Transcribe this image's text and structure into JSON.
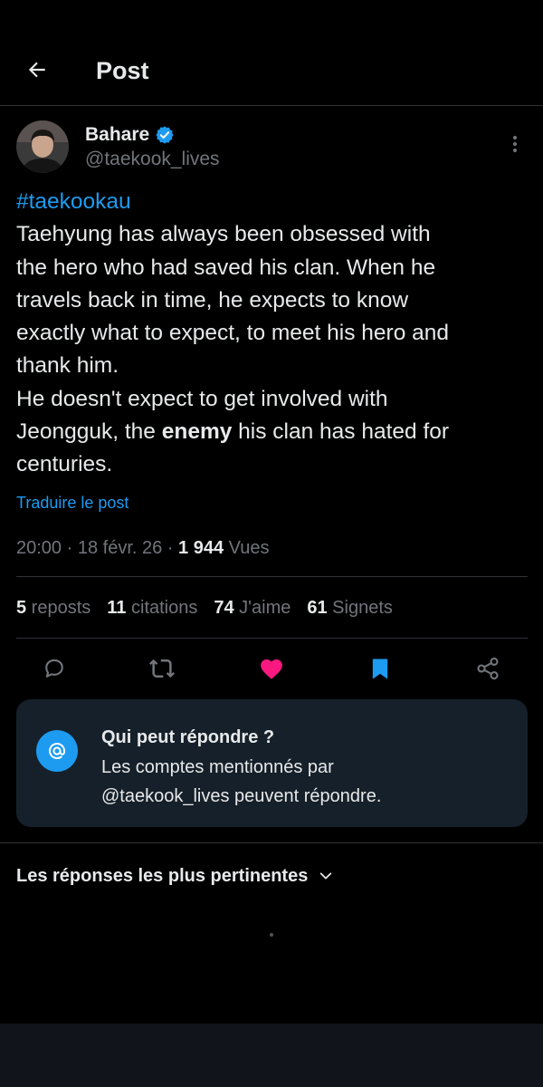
{
  "header": {
    "title": "Post",
    "back_icon": "arrow-left-icon"
  },
  "post": {
    "author_name": "Bahare",
    "author_handle": "@taekook_lives",
    "verified": true,
    "hashtag": "#taekookau",
    "lines": [
      "Taehyung has always been obsessed with",
      "the hero who had saved his clan. When he",
      "travels back in time, he expects to know",
      "exactly what to expect, to meet his hero and",
      "thank him."
    ],
    "line6": "He doesn't expect to get involved with",
    "line7": {
      "before": "Jeongguk, the ",
      "bold": "enemy",
      "after": " his clan has hated for"
    },
    "line8": "centuries.",
    "translate_label": "Traduire le post",
    "meta": {
      "time": "20:00",
      "sep": " · ",
      "date": "18 févr. 26",
      "views_count": "1 944",
      "views_label": " Vues"
    }
  },
  "stats": [
    {
      "num": "5",
      "label": " reposts"
    },
    {
      "num": "11",
      "label": " citations"
    },
    {
      "num": "74",
      "label": " J'aime"
    },
    {
      "num": "61",
      "label": " Signets"
    }
  ],
  "actions": {
    "reply_icon": "reply-icon",
    "repost_icon": "repost-icon",
    "like_icon": "heart-filled-icon",
    "bookmark_icon": "bookmark-filled-icon",
    "share_icon": "share-icon"
  },
  "reply_restriction": {
    "title": "Qui peut répondre ?",
    "line1": "Les comptes mentionnés par",
    "line2": "@taekook_lives peuvent répondre."
  },
  "replies_sort": {
    "label": "Les réponses les plus pertinentes"
  },
  "colors": {
    "background": "#000000",
    "accent": "#1d9bf0",
    "like": "#f91880",
    "text": "#e7e9ea",
    "muted": "#71767b",
    "card": "#16202a"
  }
}
